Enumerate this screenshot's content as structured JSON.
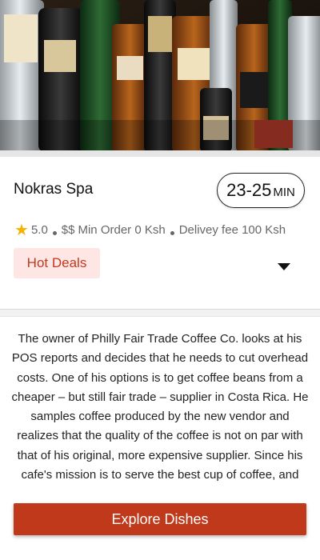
{
  "hero": {
    "image": "liquor-bottles-photo"
  },
  "restaurant": {
    "name": "Nokras Spa",
    "delivery_time": {
      "range": "23-25",
      "unit": "MIN"
    },
    "rating": "5.0",
    "price_level": "$$",
    "min_order": "Min Order 0 Ksh",
    "delivery_fee": "Delivey fee 100 Ksh"
  },
  "deals": {
    "label": "Hot Deals"
  },
  "description": "The owner of Philly Fair Trade Coffee Co. looks at his POS reports and decides that he needs to cut overhead costs. One of his options is to get coffee beans from a cheaper – but still fair trade – supplier in Costa Rica. He samples coffee produced by the new vendor and realizes that the quality of the coffee is not on par with that of his original, more expensive supplier. Since his cafe's mission is to serve the best cup of coffee, and",
  "cta": {
    "label": "Explore Dishes"
  },
  "colors": {
    "accent": "#c0391b",
    "deals_bg": "#fde6e3",
    "deals_text": "#c03a1e",
    "star": "#f5b301"
  }
}
